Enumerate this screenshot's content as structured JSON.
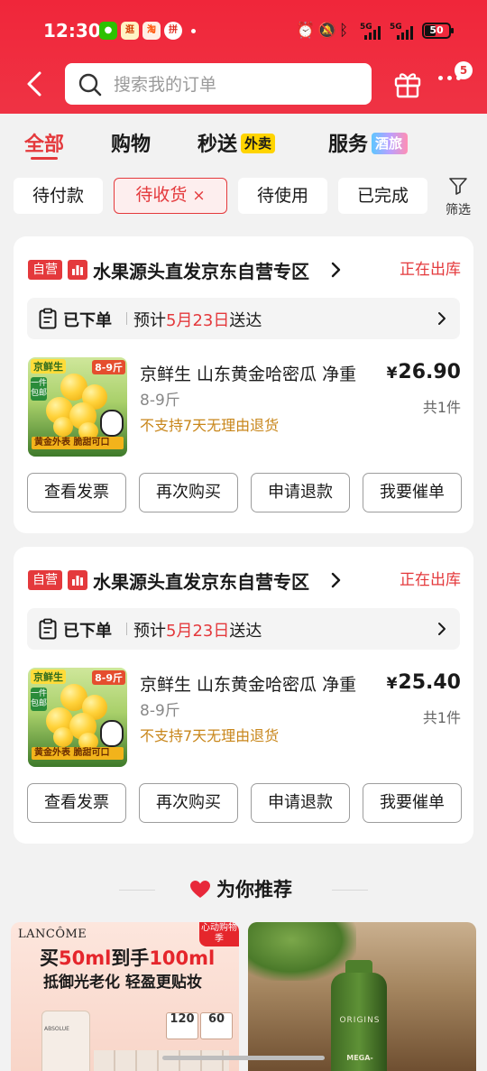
{
  "status_bar": {
    "time": "12:30",
    "app_icons": [
      {
        "name": "wechat-icon",
        "text": "",
        "color": "#2dc100"
      },
      {
        "name": "nearby-app-icon",
        "text": "逛",
        "color": "#f4a300"
      },
      {
        "name": "taobao-icon",
        "text": "淘",
        "color": "#ff5000"
      },
      {
        "name": "pinduoduo-icon",
        "text": "拼",
        "color": "#e02e24"
      }
    ],
    "network_1": "5G",
    "network_2": "5G",
    "battery": "50",
    "battery_level": 0.5
  },
  "header": {
    "search_placeholder": "搜索我的订单",
    "notification_count": "5"
  },
  "tabs": [
    {
      "label": "全部",
      "active": true
    },
    {
      "label": "购物",
      "active": false
    },
    {
      "label": "秒送",
      "tag": "外卖",
      "active": false
    },
    {
      "label": "服务",
      "tag": "酒旅",
      "active": false
    }
  ],
  "chips": [
    {
      "label": "待付款"
    },
    {
      "label": "待收货",
      "selected": true,
      "close": "×"
    },
    {
      "label": "待使用"
    },
    {
      "label": "已完成"
    }
  ],
  "filter_label": "筛选",
  "orders": [
    {
      "badge": "自营",
      "shop": "水果源头直发京东自营专区",
      "status": "正在出库",
      "placed": "已下单",
      "eta_prefix": "预计",
      "eta_date": "5月23日",
      "eta_suffix": "送达",
      "product": {
        "image": {
          "brand": "京鲜生",
          "spec": "8-9斤",
          "tag": "一件包邮",
          "banner": "黄金外表 脆甜可口"
        },
        "title": "京鲜生 山东黄金哈密瓜 净重",
        "spec": "8-9斤",
        "note": "不支持7天无理由退货",
        "currency": "¥",
        "price": "26.90",
        "qty": "共1件"
      },
      "actions": [
        "查看发票",
        "再次购买",
        "申请退款",
        "我要催单"
      ]
    },
    {
      "badge": "自营",
      "shop": "水果源头直发京东自营专区",
      "status": "正在出库",
      "placed": "已下单",
      "eta_prefix": "预计",
      "eta_date": "5月23日",
      "eta_suffix": "送达",
      "product": {
        "image": {
          "brand": "京鲜生",
          "spec": "8-9斤",
          "tag": "一件包邮",
          "banner": "黄金外表 脆甜可口"
        },
        "title": "京鲜生 山东黄金哈密瓜 净重",
        "spec": "8-9斤",
        "note": "不支持7天无理由退货",
        "currency": "¥",
        "price": "25.40",
        "qty": "共1件"
      },
      "actions": [
        "查看发票",
        "再次购买",
        "申请退款",
        "我要催单"
      ]
    }
  ],
  "recommend": {
    "title": "为你推荐",
    "items": [
      {
        "brand": "LANCÔME",
        "promo": "心动购物季",
        "headline_pre": "买",
        "headline_a": "50ml",
        "headline_mid": "到手",
        "headline_b": "100ml",
        "sub": "抵御光老化 轻盈更贴妆",
        "product_text": "ABSOLUE",
        "coupons": [
          "120",
          "60"
        ]
      },
      {
        "brand": "ORIGINS",
        "product_text": "MEGA-"
      }
    ]
  },
  "colors": {
    "brand_red": "#e4393c",
    "header_red": "#f0263a",
    "note_orange": "#c8861a"
  }
}
